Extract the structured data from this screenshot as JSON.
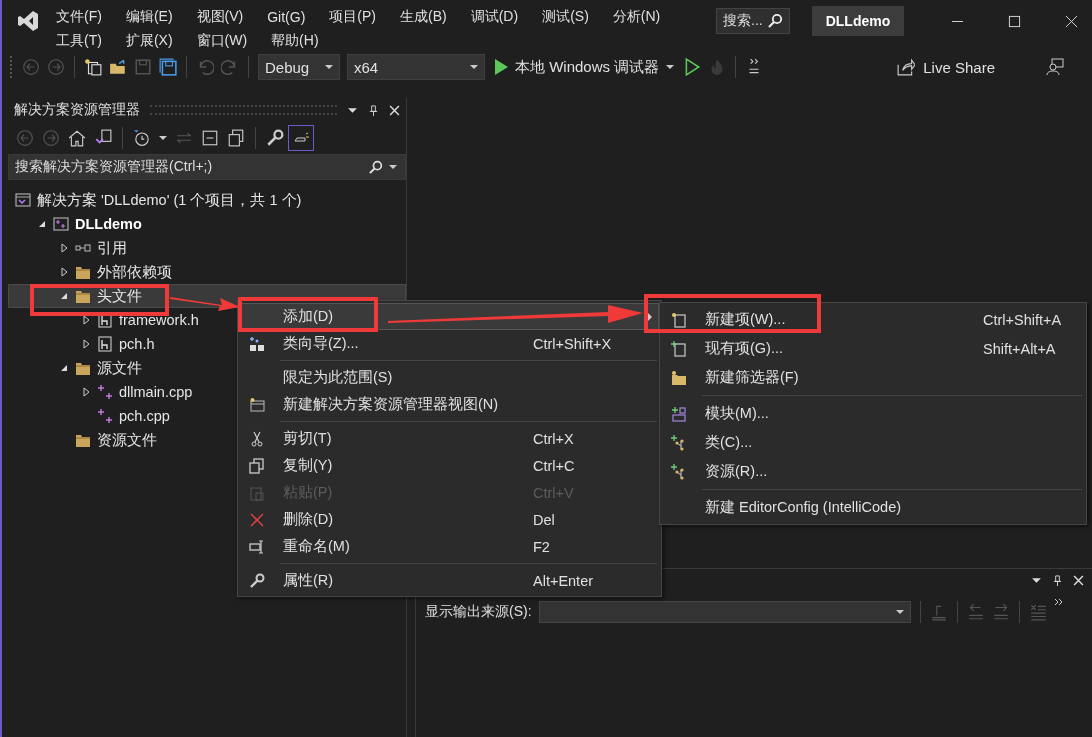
{
  "window": {
    "title": "DLLdemo",
    "search": {
      "placeholder": "搜索..."
    }
  },
  "menu_bar": [
    [
      "文件(F)",
      "编辑(E)",
      "视图(V)",
      "Git(G)",
      "项目(P)",
      "生成(B)",
      "调试(D)",
      "测试(S)",
      "分析(N)"
    ],
    [
      "工具(T)",
      "扩展(X)",
      "窗口(W)",
      "帮助(H)"
    ]
  ],
  "toolbar": {
    "configuration": "Debug",
    "platform": "x64",
    "debugger": "本地 Windows 调试器",
    "live_share": "Live Share"
  },
  "solution_explorer": {
    "title": "解决方案资源管理器",
    "search": {
      "placeholder": "搜索解决方案资源管理器(Ctrl+;)"
    },
    "tree": [
      {
        "label": "解决方案 'DLLdemo' (1 个项目，共 1 个)",
        "kind": "solution",
        "selected": false,
        "children": [
          {
            "label": "DLLdemo",
            "kind": "project",
            "bold": true,
            "expanded": true,
            "selected": false,
            "children": [
              {
                "label": "引用",
                "kind": "reference",
                "expanded": false,
                "selected": false
              },
              {
                "label": "外部依赖项",
                "kind": "external",
                "expanded": false,
                "selected": false
              },
              {
                "label": "头文件",
                "kind": "filter",
                "expanded": true,
                "selected": true,
                "children": [
                  {
                    "label": "framework.h",
                    "kind": "header",
                    "expanded": false,
                    "selected": false
                  },
                  {
                    "label": "pch.h",
                    "kind": "header",
                    "expanded": false,
                    "selected": false
                  }
                ]
              },
              {
                "label": "源文件",
                "kind": "filter",
                "expanded": true,
                "selected": false,
                "children": [
                  {
                    "label": "dllmain.cpp",
                    "kind": "source",
                    "expanded": false,
                    "selected": false
                  },
                  {
                    "label": "pch.cpp",
                    "kind": "source",
                    "selected": false
                  }
                ]
              },
              {
                "label": "资源文件",
                "kind": "filter",
                "selected": false
              }
            ]
          }
        ]
      }
    ]
  },
  "context_menu": {
    "groups": [
      [
        {
          "label": "添加(D)",
          "kind": "add",
          "submenu": true,
          "selected": true,
          "disabled": false
        },
        {
          "label": "类向导(Z)...",
          "kind": "wizard",
          "shortcut": "Ctrl+Shift+X",
          "selected": false,
          "disabled": false
        }
      ],
      [
        {
          "label": "限定为此范围(S)",
          "kind": "scope",
          "selected": false,
          "disabled": false
        },
        {
          "label": "新建解决方案资源管理器视图(N)",
          "kind": "new-view",
          "selected": false,
          "disabled": false
        }
      ],
      [
        {
          "label": "剪切(T)",
          "kind": "cut",
          "shortcut": "Ctrl+X",
          "selected": false,
          "disabled": false
        },
        {
          "label": "复制(Y)",
          "kind": "copy",
          "shortcut": "Ctrl+C",
          "selected": false,
          "disabled": false
        },
        {
          "label": "粘贴(P)",
          "kind": "paste",
          "shortcut": "Ctrl+V",
          "selected": false,
          "disabled": true
        },
        {
          "label": "删除(D)",
          "kind": "delete",
          "shortcut": "Del",
          "selected": false,
          "disabled": false
        },
        {
          "label": "重命名(M)",
          "kind": "rename",
          "shortcut": "F2",
          "selected": false,
          "disabled": false
        }
      ],
      [
        {
          "label": "属性(R)",
          "kind": "properties",
          "shortcut": "Alt+Enter",
          "selected": false,
          "disabled": false
        }
      ]
    ]
  },
  "submenu": {
    "groups": [
      [
        {
          "label": "新建项(W)...",
          "kind": "new-item",
          "shortcut": "Ctrl+Shift+A"
        },
        {
          "label": "现有项(G)...",
          "kind": "existing-item",
          "shortcut": "Shift+Alt+A"
        },
        {
          "label": "新建筛选器(F)",
          "kind": "new-filter"
        }
      ],
      [
        {
          "label": "模块(M)...",
          "kind": "module"
        },
        {
          "label": "类(C)...",
          "kind": "class"
        },
        {
          "label": "资源(R)...",
          "kind": "resource"
        }
      ],
      [
        {
          "label": "新建 EditorConfig (IntelliCode)",
          "kind": "plain"
        }
      ]
    ]
  },
  "output": {
    "source_label": "显示输出来源(S):"
  }
}
